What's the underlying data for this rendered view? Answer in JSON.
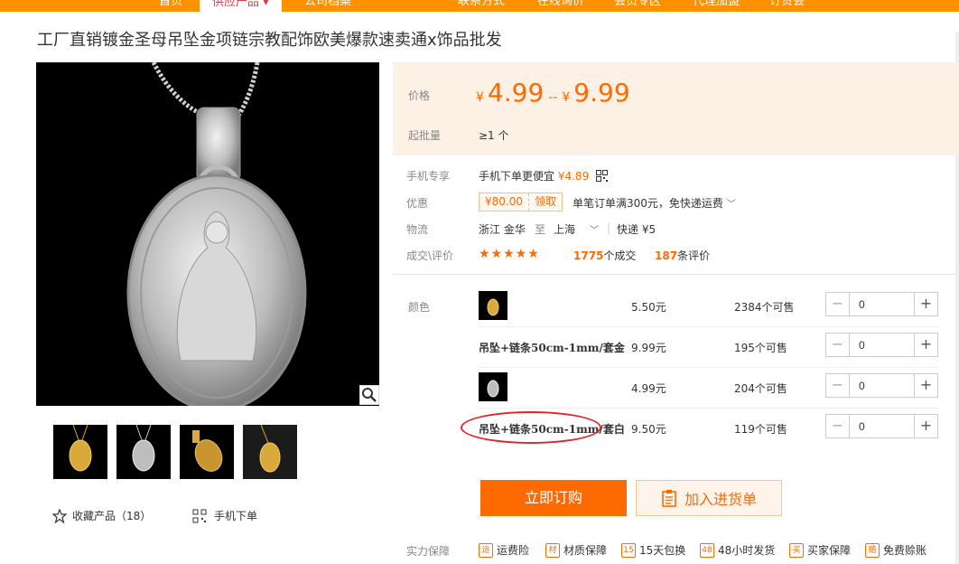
{
  "nav": {
    "items": [
      "首页",
      "供应产品",
      "公司档案",
      "联系方式",
      "在线询价",
      "会员专区",
      "代理加盟",
      "订货会"
    ]
  },
  "product": {
    "title": "工厂直销镀金圣母吊坠金项链宗教配饰欧美爆款速卖通x饰品批发"
  },
  "price": {
    "label": "价格",
    "currency": "¥",
    "low": "4.99",
    "dash": "--",
    "high": "9.99"
  },
  "moq": {
    "label": "起批量",
    "value": "≥1 个"
  },
  "mobile": {
    "label": "手机专享",
    "text": "手机下单更便宜",
    "price": "¥4.89"
  },
  "promo": {
    "label": "优惠",
    "coupon": "¥80.00",
    "claim": "领取",
    "text": "单笔订单满300元，免快递运费"
  },
  "logistics": {
    "label": "物流",
    "from": "浙江 金华",
    "to_label": "至",
    "to": "上海",
    "method": "快递",
    "fee": "¥5"
  },
  "reviews": {
    "label": "成交\\评价",
    "stars": "★★★★★",
    "deals": "1775",
    "deals_unit": "个成交",
    "count": "187",
    "count_unit": "条评价"
  },
  "sku": {
    "label": "颜色",
    "rows": [
      {
        "name": "",
        "price": "5.50元",
        "stock": "2384个可售",
        "qty": "0"
      },
      {
        "name": "吊坠+链条50cm-1mm/套金",
        "price": "9.99元",
        "stock": "195个可售",
        "qty": "0"
      },
      {
        "name": "",
        "price": "4.99元",
        "stock": "204个可售",
        "qty": "0"
      },
      {
        "name": "吊坠+链条50cm-1mm/套白",
        "price": "9.50元",
        "stock": "119个可售",
        "qty": "0"
      }
    ]
  },
  "actions": {
    "order": "立即订购",
    "cart": "加入进货单"
  },
  "favorite": {
    "label": "收藏产品（18）"
  },
  "mobile_order": {
    "label": "手机下单"
  },
  "guarantee": {
    "label": "实力保障",
    "items": [
      {
        "icon": "运",
        "text": "运费险"
      },
      {
        "icon": "材",
        "text": "材质保障"
      },
      {
        "icon": "15",
        "text": "15天包换"
      },
      {
        "icon": "48",
        "text": "48小时发货"
      },
      {
        "icon": "买",
        "text": "买家保障"
      },
      {
        "icon": "赔",
        "text": "免费赊账"
      }
    ]
  },
  "colors": {
    "accent": "#ff6a00",
    "nav": "#ff9100",
    "price_bg": "#fdf0e4",
    "annotation": "#e0262c"
  }
}
